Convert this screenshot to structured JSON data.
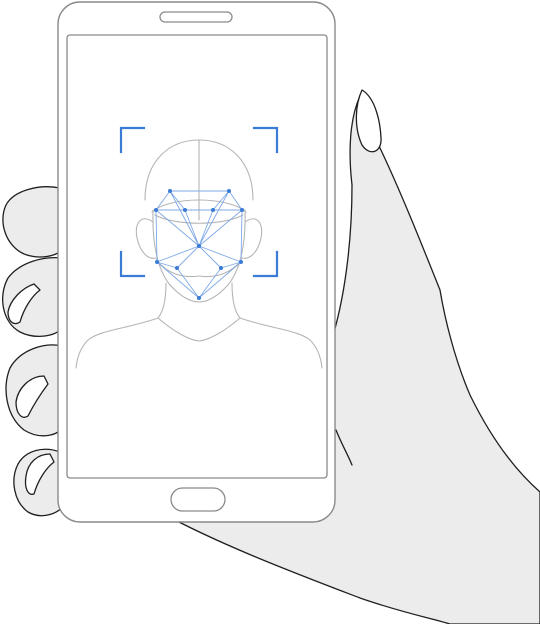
{
  "illustration": {
    "subject": "face-id-scan",
    "colors": {
      "outline": "#1f1f1f",
      "phone_stroke": "#8a8a8a",
      "hand_fill": "#ececec",
      "screen_fill": "#ffffff",
      "head_stroke": "#b5b5b5",
      "scan_accent": "#3a7bd5",
      "mesh_line": "#7fa9e6"
    },
    "icons": [
      "phone-icon",
      "hand-icon",
      "face-outline-icon",
      "face-mesh-icon",
      "scan-frame-icon"
    ]
  }
}
